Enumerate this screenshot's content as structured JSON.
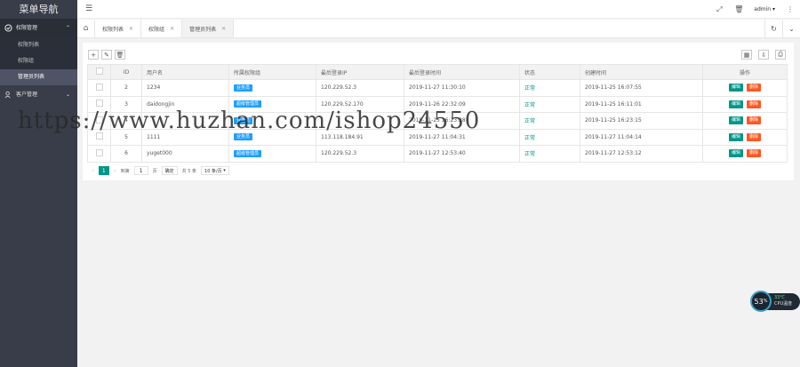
{
  "sidebar": {
    "title": "菜单导航",
    "groups": [
      {
        "label": "权限管理",
        "items": [
          {
            "label": "权限列表"
          },
          {
            "label": "权限组"
          },
          {
            "label": "管理员列表"
          }
        ]
      },
      {
        "label": "客户管理"
      }
    ]
  },
  "header": {
    "user": "admin"
  },
  "tabs": [
    {
      "label": "权限列表"
    },
    {
      "label": "权限组"
    },
    {
      "label": "管理员列表"
    }
  ],
  "table": {
    "headers": [
      "ID",
      "用户名",
      "所属权限组",
      "最后登录IP",
      "最后登录时间",
      "状态",
      "创建时间",
      "操作"
    ],
    "rows": [
      {
        "id": "2",
        "username": "1234",
        "group": "业务员",
        "ip": "120.229.52.3",
        "last_login": "2019-11-27 11:30:10",
        "status": "正常",
        "created": "2019-11-25 16:07:55"
      },
      {
        "id": "3",
        "username": "daidongjin",
        "group": "超级管理员",
        "ip": "120.229.52.170",
        "last_login": "2019-11-26 22:32:09",
        "status": "正常",
        "created": "2019-11-25 16:11:01"
      },
      {
        "id": "4",
        "username": "",
        "group": "业务员",
        "ip": "",
        "last_login": "2019-11-25 16:23:28",
        "status": "正常",
        "created": "2019-11-25 16:23:15"
      },
      {
        "id": "5",
        "username": "1111",
        "group": "业务员",
        "ip": "113.118.184.91",
        "last_login": "2019-11-27 11:04:31",
        "status": "正常",
        "created": "2019-11-27 11:04:14"
      },
      {
        "id": "6",
        "username": "yuget000",
        "group": "超级管理员",
        "ip": "120.229.52.3",
        "last_login": "2019-11-27 12:53:40",
        "status": "正常",
        "created": "2019-11-27 12:53:12"
      }
    ],
    "edit_label": "编辑",
    "delete_label": "删除"
  },
  "pager": {
    "current": "1",
    "goto_label": "到第",
    "page_input": "1",
    "page_unit": "页",
    "confirm": "确定",
    "total": "共 5 条",
    "per_page": "10 条/页"
  },
  "watermark": "https://www.huzhan.com/ishop24550",
  "cpu": {
    "percent": "53",
    "unit": "%",
    "temp": "33℃",
    "label": "CPU温度"
  }
}
